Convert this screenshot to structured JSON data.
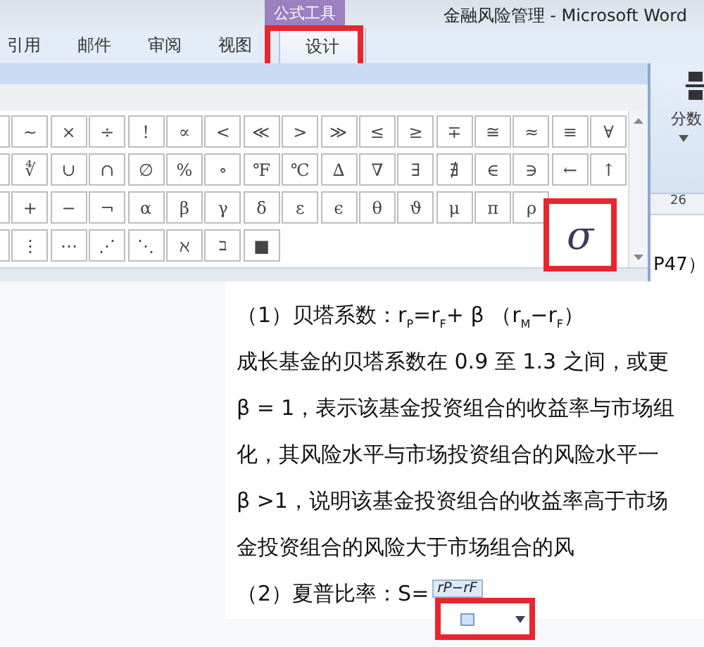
{
  "window": {
    "title": "金融风险管理 - Microsoft Word",
    "context_group": "公式工具"
  },
  "tabs": [
    {
      "label": "引用",
      "selected": false
    },
    {
      "label": "邮件",
      "selected": false
    },
    {
      "label": "审阅",
      "selected": false
    },
    {
      "label": "视图",
      "selected": false
    },
    {
      "label": "设计",
      "selected": true,
      "highlighted": true
    }
  ],
  "symbol_gallery": {
    "rows": [
      [
        "~",
        "×",
        "÷",
        "!",
        "∝",
        "<",
        "≪",
        ">",
        "≫",
        "≤",
        "≥",
        "∓",
        "≅",
        "≈",
        "≡",
        "∀"
      ],
      [
        "∜",
        "∪",
        "∩",
        "∅",
        "%",
        "∘",
        "℉",
        "℃",
        "∆",
        "∇",
        "∃",
        "∄",
        "∈",
        "∋",
        "←",
        "↑"
      ],
      [
        "+",
        "−",
        "¬",
        "α",
        "β",
        "γ",
        "δ",
        "ε",
        "ϵ",
        "θ",
        "ϑ",
        "μ",
        "π",
        "ρ"
      ],
      [
        "⋮",
        "⋯",
        "⋰",
        "⋱",
        "ℵ",
        "ב",
        "■"
      ]
    ],
    "preview": "σ"
  },
  "ribbon": {
    "fraction_button": "分数"
  },
  "ruler": {
    "mark": "26"
  },
  "document": {
    "fragment": "P47）",
    "lines": [
      "（1）贝塔系数：r$_{P}$=r$_{F}$+ β （r$_{M}$−r$_{F}$）",
      "成长基金的贝塔系数在 0.9 至 1.3 之间，或更",
      "β = 1，表示该基金投资组合的收益率与市场组",
      "化，其风险水平与市场投资组合的风险水平一",
      "β >1，说明该基金投资组合的收益率高于市场",
      "金投资组合的风险大于市场组合的风"
    ],
    "equation": {
      "prefix": "（2）夏普比率：S=",
      "numerator": "rP−rF"
    }
  }
}
